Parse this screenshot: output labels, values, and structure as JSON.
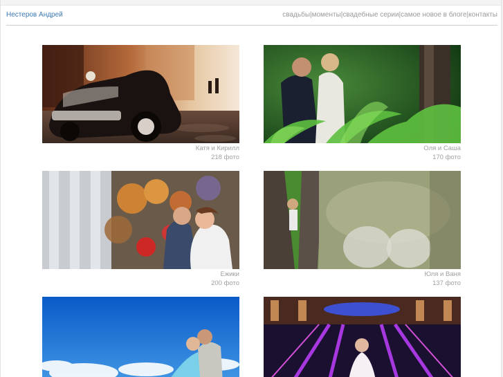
{
  "header": {
    "site_title": "Нестеров Андрей",
    "nav": [
      {
        "label": "свадьбы"
      },
      {
        "label": "моменты"
      },
      {
        "label": "свадебные серии"
      },
      {
        "label": "самое новое в блоге"
      },
      {
        "label": "контакты"
      }
    ],
    "separator": "|"
  },
  "albums": [
    {
      "title": "Катя и Кирилл",
      "count": "218 фото"
    },
    {
      "title": "Оля и Саша",
      "count": "170 фото"
    },
    {
      "title": "Ежики",
      "count": "200 фото"
    },
    {
      "title": "Юля и Ваня",
      "count": "137 фото"
    },
    {
      "title": "",
      "count": ""
    },
    {
      "title": "",
      "count": ""
    }
  ],
  "colors": {
    "link_blue": "#3a78b0",
    "muted_gray": "#9a9a9a"
  }
}
